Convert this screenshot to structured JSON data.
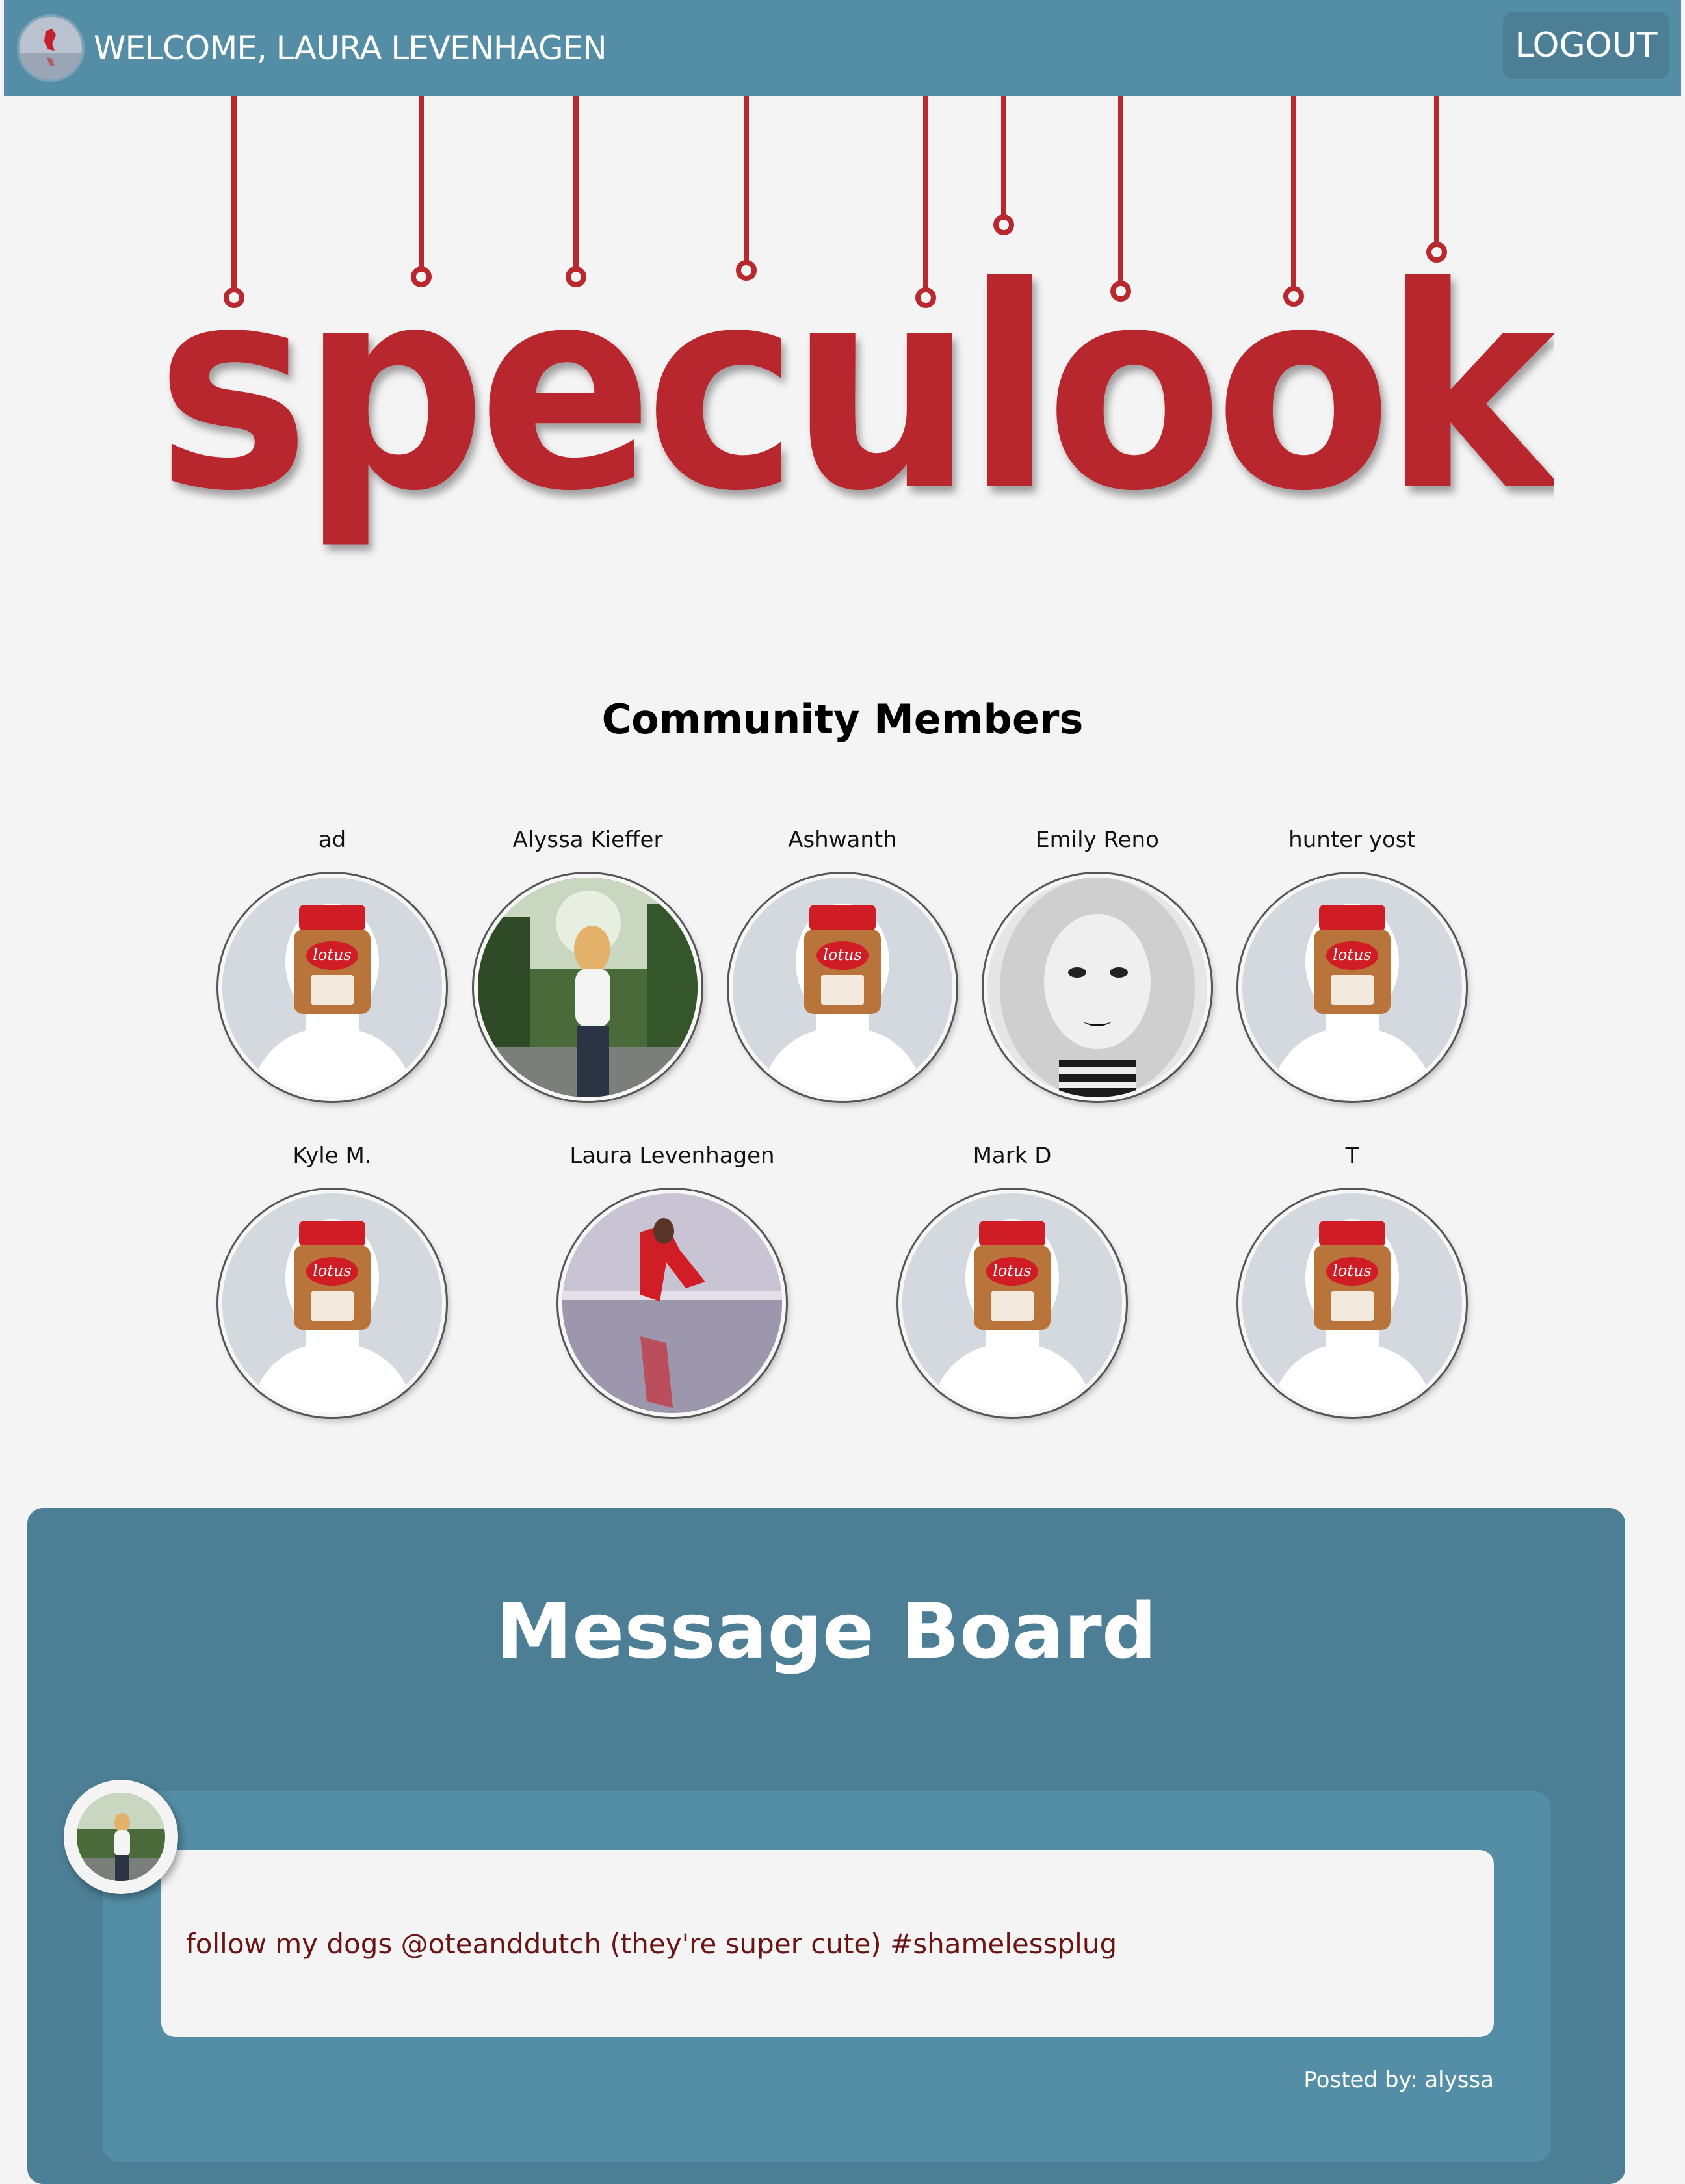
{
  "header": {
    "welcome_text": "WELCOME, LAURA LEVENHAGEN",
    "logout_label": "LOGOUT",
    "avatar_icon": "user-avatar"
  },
  "logo": {
    "text": "speculook",
    "color": "#b8282e"
  },
  "community": {
    "title": "Community Members",
    "members": [
      {
        "name": "ad",
        "avatar": "lotus-jar-silhouette"
      },
      {
        "name": "Alyssa Kieffer",
        "avatar": "photo-outdoor-woman"
      },
      {
        "name": "Ashwanth",
        "avatar": "lotus-jar-silhouette"
      },
      {
        "name": "Emily Reno",
        "avatar": "photo-bw-portrait"
      },
      {
        "name": "hunter yost",
        "avatar": "lotus-jar-silhouette"
      },
      {
        "name": "Kyle M.",
        "avatar": "lotus-jar-silhouette"
      },
      {
        "name": "Laura Levenhagen",
        "avatar": "photo-beach-red-dress"
      },
      {
        "name": "Mark D",
        "avatar": "lotus-jar-silhouette"
      },
      {
        "name": "T",
        "avatar": "lotus-jar-silhouette"
      }
    ]
  },
  "board": {
    "title": "Message Board",
    "posts": [
      {
        "text": "follow my dogs @oteanddutch (they're super cute) #shamelessplug",
        "meta": "Posted by: alyssa"
      }
    ]
  },
  "colors": {
    "header_bg": "#548da6",
    "board_bg": "#4c7f95",
    "card_bg": "#548da6",
    "logo_red": "#b8282e",
    "page_bg": "#f4f4f4"
  }
}
